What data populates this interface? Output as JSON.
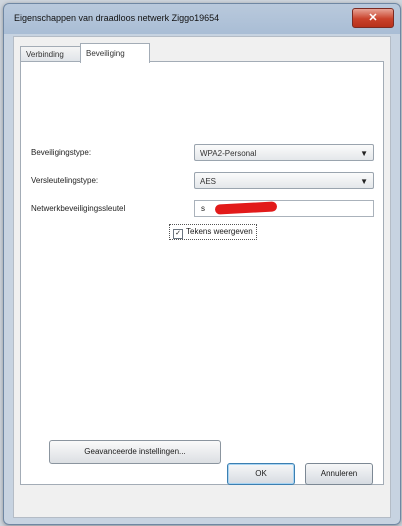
{
  "window": {
    "title": "Eigenschappen van draadloos netwerk Ziggo19654",
    "close_label": "✕"
  },
  "tabs": [
    {
      "label": "Verbinding"
    },
    {
      "label": "Beveiliging"
    }
  ],
  "security": {
    "type_label": "Beveiligingstype:",
    "type_value": "WPA2-Personal",
    "encryption_label": "Versleutelingstype:",
    "encryption_value": "AES",
    "key_label": "Netwerkbeveiligingssleutel",
    "key_value": "s",
    "show_chars_checked": "✓",
    "show_chars_label": "Tekens weergeven"
  },
  "buttons": {
    "advanced": "Geavanceerde instellingen...",
    "ok": "OK",
    "cancel": "Annuleren"
  },
  "icons": {
    "dropdown_arrow": "▼"
  }
}
